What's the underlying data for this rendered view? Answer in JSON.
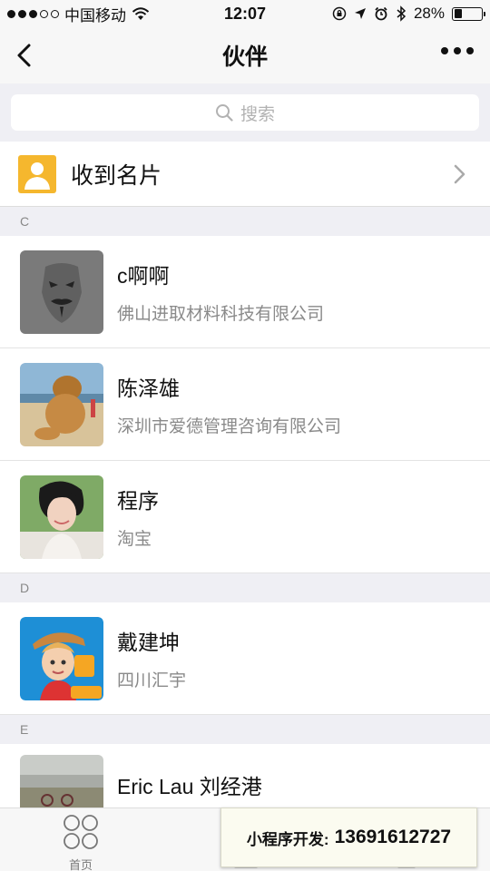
{
  "statusbar": {
    "carrier": "中国移动",
    "time": "12:07",
    "battery": "28%",
    "battery_level": 0.28
  },
  "navbar": {
    "title": "伙伴"
  },
  "search": {
    "placeholder": "搜索"
  },
  "card_entry": {
    "label": "收到名片"
  },
  "sections": [
    {
      "letter": "C",
      "contacts": [
        {
          "name": "c啊啊",
          "company": "佛山进取材料科技有限公司"
        },
        {
          "name": "陈泽雄",
          "company": "深圳市爱德管理咨询有限公司"
        },
        {
          "name": "程序",
          "company": "淘宝"
        }
      ]
    },
    {
      "letter": "D",
      "contacts": [
        {
          "name": "戴建坤",
          "company": "四川汇宇"
        }
      ]
    },
    {
      "letter": "E",
      "contacts": [
        {
          "name": "Eric Lau 刘经港",
          "company": ""
        }
      ]
    }
  ],
  "tabbar": {
    "home_label": "首页"
  },
  "promo": {
    "label": "小程序开发:",
    "phone": "13691612727"
  },
  "colors": {
    "card_icon": "#f5b72e",
    "background": "#efeff4"
  }
}
